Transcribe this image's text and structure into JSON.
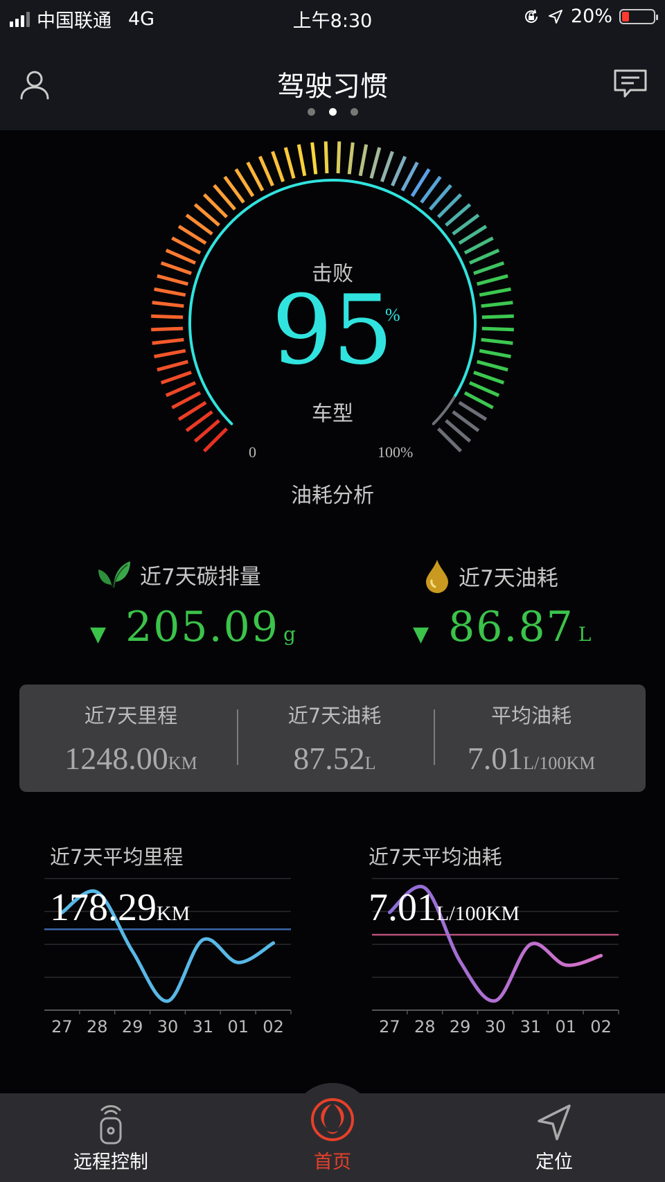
{
  "status_bar": {
    "carrier": "中国联通",
    "network": "4G",
    "time": "上午8:30",
    "battery": "20%",
    "battery_level": 0.2
  },
  "header": {
    "title": "驾驶习惯",
    "page_dots": 3,
    "active_dot": 1,
    "left_icon": "user-icon",
    "right_icon": "message-icon"
  },
  "gauge": {
    "top_label": "击败",
    "value": "95",
    "unit": "%",
    "bottom_label": "车型",
    "min_label": "0",
    "max_label": "100%",
    "caption": "油耗分析",
    "level": 0.95,
    "arc_color": "#31e3de"
  },
  "summary": {
    "carbon": {
      "title": "近7天碳排量",
      "value": "205.09",
      "unit": "g",
      "icon": "leaf-icon",
      "trend": "▼"
    },
    "fuel": {
      "title": "近7天油耗",
      "value": "86.87",
      "unit": "L",
      "icon": "oil-drop-icon",
      "trend": "▼"
    }
  },
  "panel": {
    "mileage": {
      "label": "近7天里程",
      "value": "1248.00",
      "unit": "KM"
    },
    "fuel": {
      "label": "近7天油耗",
      "value": "87.52",
      "unit": "L"
    },
    "avg": {
      "label": "平均油耗",
      "value": "7.01",
      "unit": "L/100KM"
    }
  },
  "chart_data": [
    {
      "type": "line",
      "title": "近7天平均里程",
      "headline_value": "178.29",
      "headline_unit": "KM",
      "categories": [
        "27",
        "28",
        "29",
        "30",
        "31",
        "01",
        "02"
      ],
      "values": [
        215,
        260,
        130,
        20,
        155,
        105,
        148
      ],
      "reference_line": 178.29,
      "ylim": [
        0,
        290
      ],
      "line_color": "#58b8e6",
      "reference_color": "#3b66a8"
    },
    {
      "type": "line",
      "title": "近7天平均油耗",
      "headline_value": "7.01",
      "headline_unit": "L/100KM",
      "categories": [
        "27",
        "28",
        "29",
        "30",
        "31",
        "01",
        "02"
      ],
      "values": [
        8.2,
        9.5,
        5.6,
        3.5,
        6.5,
        5.4,
        5.9
      ],
      "reference_line": 7.01,
      "ylim": [
        3,
        10
      ],
      "line_color_start": "#8b6ed8",
      "line_color_end": "#d871c9",
      "reference_color": "#b8507a"
    }
  ],
  "tabs": [
    {
      "label": "远程控制",
      "icon": "remote-key-icon",
      "active": false
    },
    {
      "label": "首页",
      "icon": "dongfeng-logo-icon",
      "active": true
    },
    {
      "label": "定位",
      "icon": "location-arrow-icon",
      "active": false
    }
  ]
}
